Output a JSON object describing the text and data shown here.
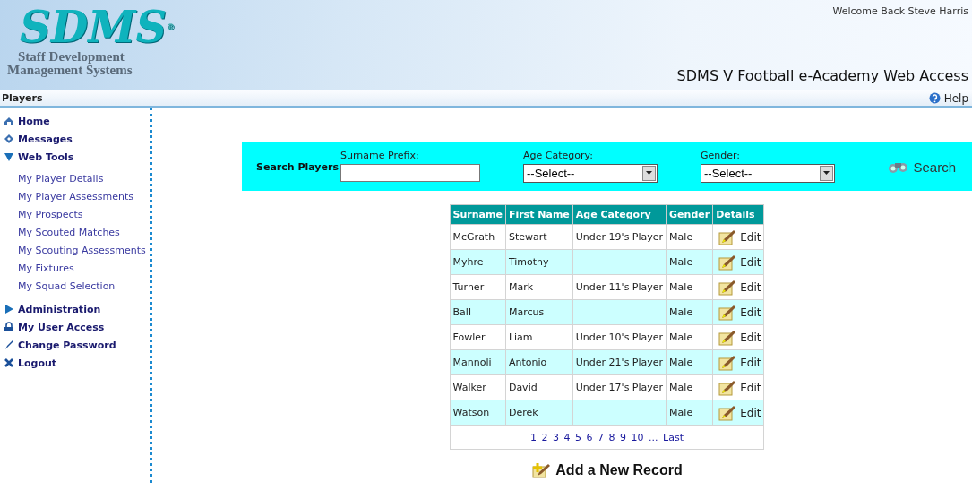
{
  "header": {
    "logo_text": "SDMS",
    "logo_mark": "®",
    "logo_subtitle_1": "Staff Development",
    "logo_subtitle_2": "Management Systems",
    "welcome": "Welcome Back Steve Harris",
    "title": "SDMS V Football e-Academy Web Access"
  },
  "breadcrumb": {
    "section": "Players",
    "help": "Help"
  },
  "sidebar": {
    "items": [
      {
        "label": "Home",
        "kind": "link"
      },
      {
        "label": "Messages",
        "kind": "link"
      },
      {
        "label": "Web Tools",
        "kind": "group",
        "expanded": true,
        "children": [
          {
            "label": "My Player Details"
          },
          {
            "label": "My Player Assessments"
          },
          {
            "label": "My Prospects"
          },
          {
            "label": "My Scouted Matches"
          },
          {
            "label": "My Scouting Assessments"
          },
          {
            "label": "My Fixtures"
          },
          {
            "label": "My Squad Selection"
          }
        ]
      },
      {
        "label": "Administration",
        "kind": "group",
        "expanded": false
      },
      {
        "label": "My User Access",
        "kind": "link"
      },
      {
        "label": "Change Password",
        "kind": "link"
      },
      {
        "label": "Logout",
        "kind": "link"
      }
    ]
  },
  "search": {
    "title": "Search Players",
    "fields": [
      {
        "label": "Surname Prefix:",
        "kind": "text"
      },
      {
        "label": "Age Category:",
        "kind": "select",
        "value": "--Select--"
      },
      {
        "label": "Gender:",
        "kind": "select",
        "value": "--Select--"
      }
    ],
    "button": "Search"
  },
  "table": {
    "columns": [
      "Surname",
      "First Name",
      "Age Category",
      "Gender",
      "Details"
    ],
    "rows": [
      [
        "McGrath",
        "Stewart",
        "Under 19's Player",
        "Male",
        "Edit"
      ],
      [
        "Myhre",
        "Timothy",
        "",
        "Male",
        "Edit"
      ],
      [
        "Turner",
        "Mark",
        "Under 11's Player",
        "Male",
        "Edit"
      ],
      [
        "Ball",
        "Marcus",
        "",
        "Male",
        "Edit"
      ],
      [
        "Fowler",
        "Liam",
        "Under 10's Player",
        "Male",
        "Edit"
      ],
      [
        "Mannoli",
        "Antonio",
        "Under 21's Player",
        "Male",
        "Edit"
      ],
      [
        "Walker",
        "David",
        "Under 17's Player",
        "Male",
        "Edit"
      ],
      [
        "Watson",
        "Derek",
        "",
        "Male",
        "Edit"
      ]
    ],
    "pages": [
      "1",
      "2",
      "3",
      "4",
      "5",
      "6",
      "7",
      "8",
      "9",
      "10",
      "...",
      "Last"
    ]
  },
  "add_button": "Add a New Record"
}
